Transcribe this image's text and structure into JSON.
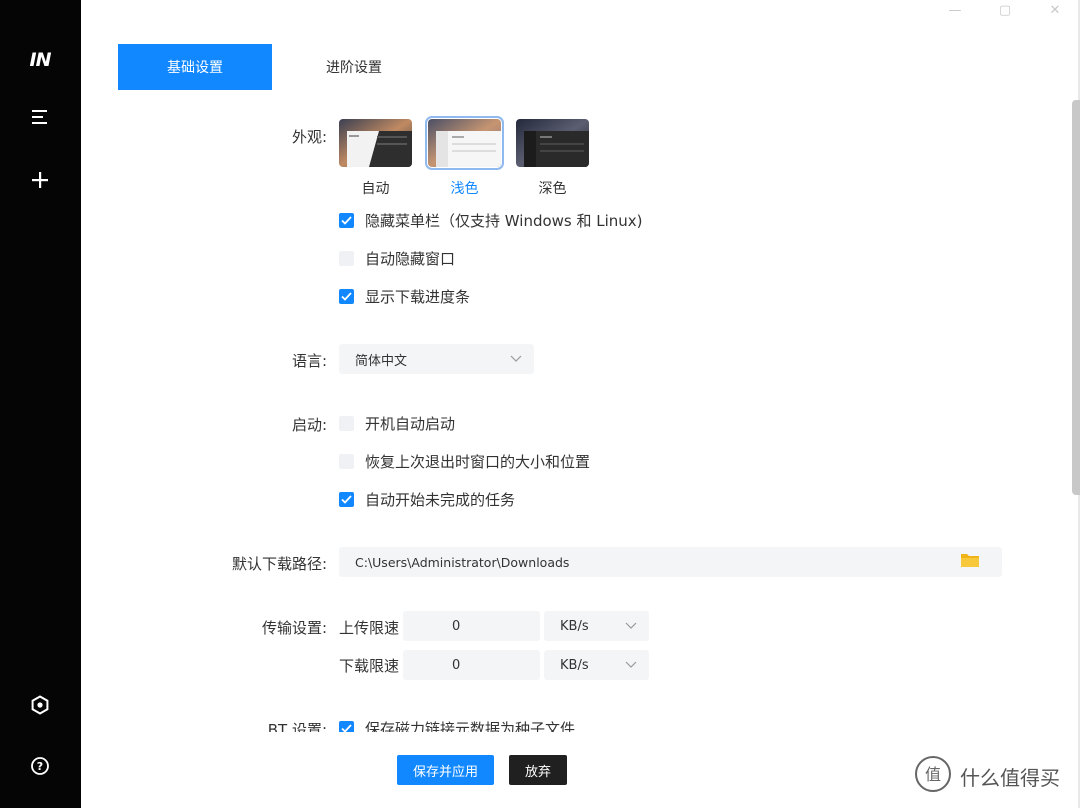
{
  "sidebar": {
    "logo": "IN",
    "items": [
      {
        "icon": "menu-icon"
      },
      {
        "icon": "plus-icon"
      },
      {
        "icon": "settings-icon"
      },
      {
        "icon": "help-icon"
      }
    ]
  },
  "window_controls": {
    "minimize": "—",
    "maximize": "▢",
    "close": "✕"
  },
  "tabs": [
    {
      "label": "基础设置",
      "active": true
    },
    {
      "label": "进阶设置",
      "active": false
    }
  ],
  "appearance": {
    "label": "外观:",
    "themes": [
      {
        "label": "自动",
        "selected": false
      },
      {
        "label": "浅色",
        "selected": true
      },
      {
        "label": "深色",
        "selected": false
      }
    ],
    "options": [
      {
        "label": "隐藏菜单栏（仅支持 Windows 和 Linux)",
        "checked": true
      },
      {
        "label": "自动隐藏窗口",
        "checked": false
      },
      {
        "label": "显示下载进度条",
        "checked": true
      }
    ]
  },
  "language": {
    "label": "语言:",
    "value": "简体中文"
  },
  "startup": {
    "label": "启动:",
    "options": [
      {
        "label": "开机自动启动",
        "checked": false
      },
      {
        "label": "恢复上次退出时窗口的大小和位置",
        "checked": false
      },
      {
        "label": "自动开始未完成的任务",
        "checked": true
      }
    ]
  },
  "download_path": {
    "label": "默认下载路径:",
    "value": "C:\\Users\\Administrator\\Downloads"
  },
  "transfer": {
    "label": "传输设置:",
    "upload_label": "上传限速",
    "upload_value": "0",
    "upload_unit": "KB/s",
    "download_label": "下载限速",
    "download_value": "0",
    "download_unit": "KB/s"
  },
  "bt": {
    "label": "BT 设置:",
    "option": "保存磁力链接元数据为种子文件",
    "checked": true
  },
  "buttons": {
    "save": "保存并应用",
    "discard": "放弃"
  },
  "watermark": {
    "text": "什么值得买"
  },
  "colors": {
    "accent": "#1188ff",
    "sidebar": "#050505",
    "dark_button": "#202020"
  }
}
